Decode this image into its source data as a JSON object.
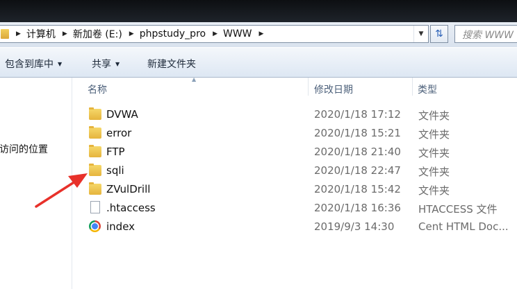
{
  "address_bar": {
    "breadcrumbs": [
      "计算机",
      "新加卷 (E:)",
      "phpstudy_pro",
      "WWW"
    ]
  },
  "search": {
    "placeholder": "搜索 WWW"
  },
  "toolbar": {
    "include_library": "包含到库中",
    "share": "共享",
    "new_folder": "新建文件夹"
  },
  "nav_pane": {
    "recent_places": "访问的位置"
  },
  "columns": {
    "name": "名称",
    "modified": "修改日期",
    "type": "类型"
  },
  "files": [
    {
      "name": "DVWA",
      "date": "2020/1/18 17:12",
      "type": "文件夹",
      "icon": "folder-icon"
    },
    {
      "name": "error",
      "date": "2020/1/18 15:21",
      "type": "文件夹",
      "icon": "folder-icon"
    },
    {
      "name": "FTP",
      "date": "2020/1/18 21:40",
      "type": "文件夹",
      "icon": "folder-icon"
    },
    {
      "name": "sqli",
      "date": "2020/1/18 22:47",
      "type": "文件夹",
      "icon": "folder-icon"
    },
    {
      "name": "ZVulDrill",
      "date": "2020/1/18 15:42",
      "type": "文件夹",
      "icon": "folder-icon"
    },
    {
      "name": ".htaccess",
      "date": "2020/1/18 16:36",
      "type": "HTACCESS 文件",
      "icon": "file-icon"
    },
    {
      "name": "index",
      "date": "2019/9/3 14:30",
      "type": "Cent HTML Doc...",
      "icon": "chrome-html-icon"
    }
  ],
  "annotation": {
    "color": "#e8312a",
    "points_to": "sqli"
  }
}
